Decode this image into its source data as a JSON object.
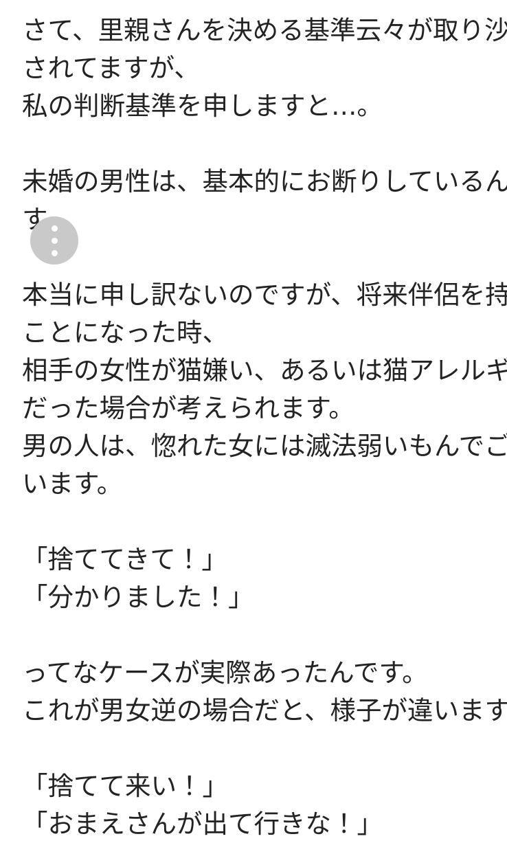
{
  "page": {
    "background_color": "#ffffff",
    "text_color": "#232323",
    "language": "ja"
  },
  "article": {
    "lines": [
      "さて、里親さんを決める基準云々が取り沙汰",
      "されてますが、",
      "私の判断基準を申しますと…。",
      "",
      "未婚の男性は、基本的にお断りしているんで",
      "す。",
      "",
      "本当に申し訳ないのですが、将来伴侶を持つ",
      "ことになった時、",
      "相手の女性が猫嫌い、あるいは猫アレルギー",
      "だった場合が考えられます。",
      "男の人は、惚れた女には滅法弱いもんでござ",
      "います。",
      "",
      "「捨ててきて！」",
      "「分かりました！」",
      "",
      "ってなケースが実際あったんです。",
      "これが男女逆の場合だと、様子が違います。",
      "",
      "「捨てて来い！」",
      "「おまえさんが出て行きな！」"
    ]
  },
  "overlay": {
    "more_options": {
      "icon": "kebab-menu-icon",
      "dot_count": 3,
      "circle_color": "#c9c9c9",
      "dot_color": "#ffffff"
    }
  }
}
